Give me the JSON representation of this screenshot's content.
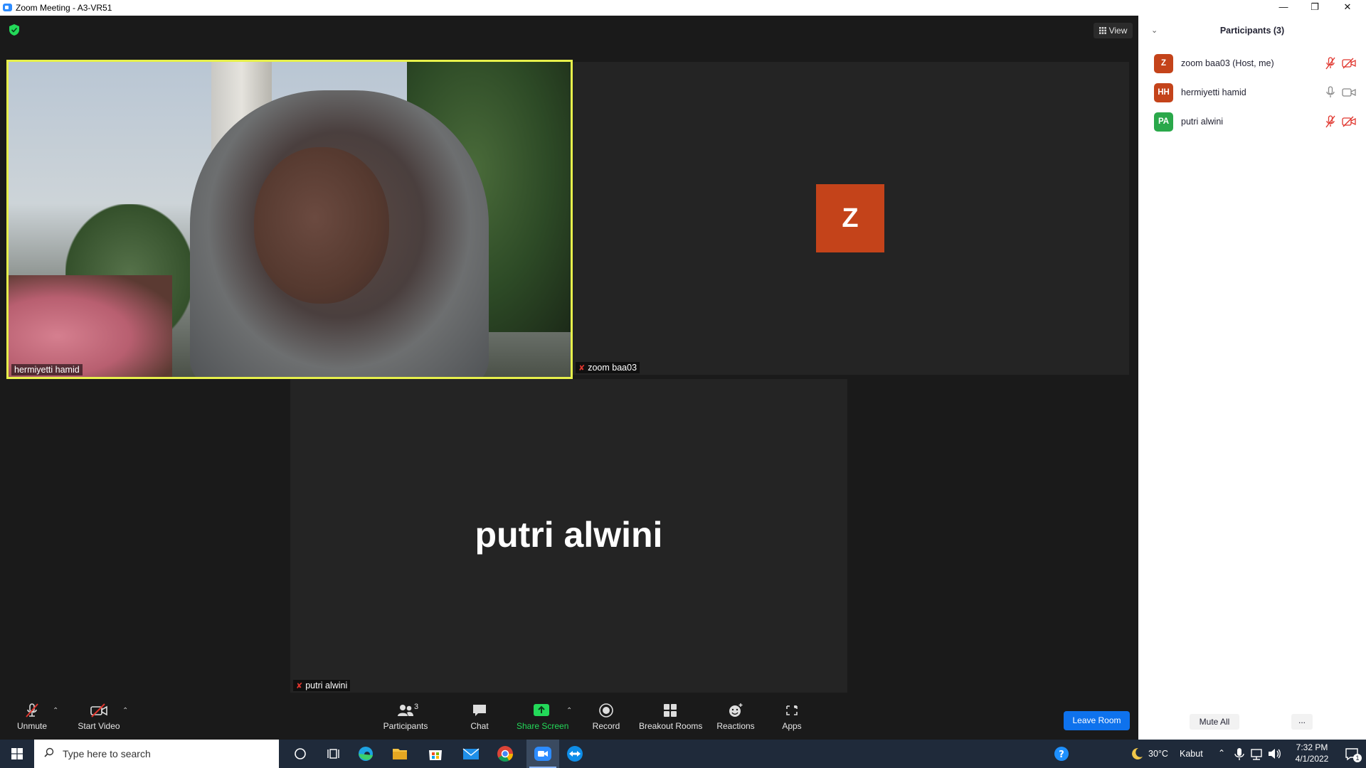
{
  "window": {
    "title": "Zoom Meeting - A3-VR51"
  },
  "view_button": {
    "label": "View"
  },
  "tiles": [
    {
      "name": "hermiyetti hamid",
      "muted": false
    },
    {
      "name": "zoom baa03",
      "avatar": "Z",
      "muted": true
    },
    {
      "name": "putri alwini",
      "display_name": "putri alwini",
      "muted": true
    }
  ],
  "toolbar": {
    "unmute": "Unmute",
    "start_video": "Start Video",
    "participants": "Participants",
    "participants_count": "3",
    "chat": "Chat",
    "share_screen": "Share Screen",
    "record": "Record",
    "breakout_rooms": "Breakout Rooms",
    "reactions": "Reactions",
    "apps": "Apps",
    "leave": "Leave Room"
  },
  "panel": {
    "title": "Participants (3)",
    "participants": [
      {
        "initials": "Z",
        "name": "zoom baa03 (Host, me)",
        "color": "#c4431a",
        "mic": "muted",
        "video": "off"
      },
      {
        "initials": "HH",
        "name": "hermiyetti hamid",
        "color": "#c4431a",
        "mic": "on",
        "video": "on"
      },
      {
        "initials": "PA",
        "name": "putri alwini",
        "color": "#2aa84a",
        "mic": "muted",
        "video": "off"
      }
    ],
    "mute_all": "Mute All",
    "more": "..."
  },
  "taskbar": {
    "search_placeholder": "Type here to search",
    "weather_temp": "30°C",
    "weather_desc": "Kabut",
    "time": "7:32 PM",
    "date": "4/1/2022",
    "notification_count": "1"
  },
  "colors": {
    "accent": "#0e72ed",
    "active_speaker": "#e7f04b",
    "share_green": "#23d959",
    "muted_red": "#e0362e"
  }
}
